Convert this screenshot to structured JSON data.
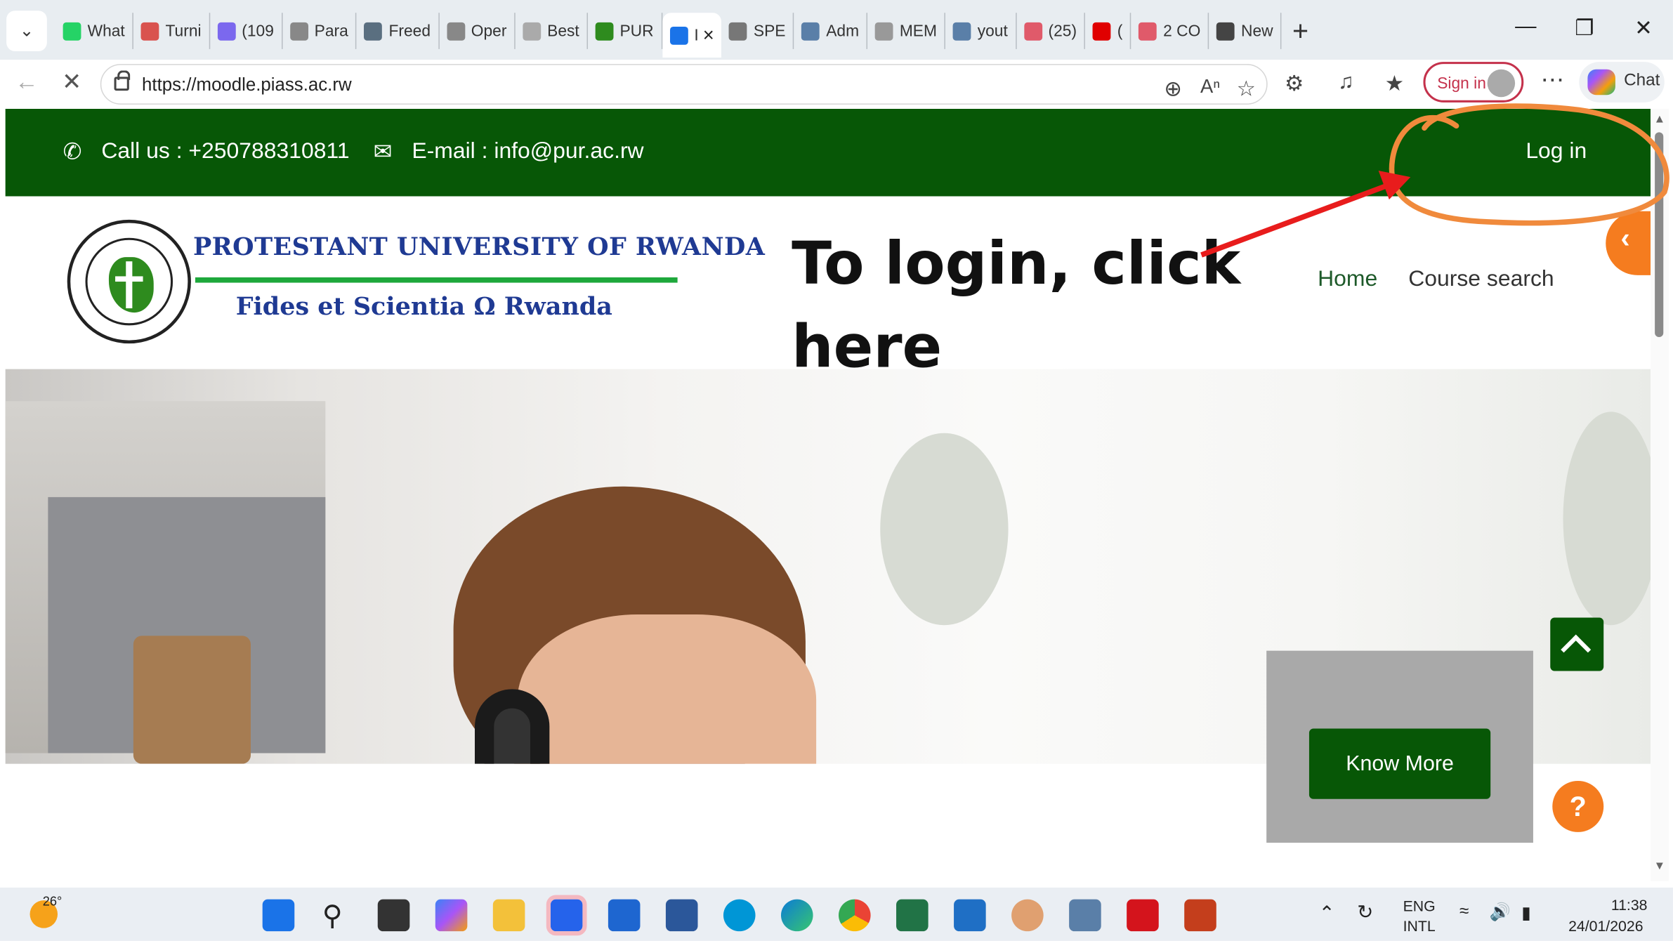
{
  "browser": {
    "tabs": [
      {
        "label": "What",
        "icon": "whatsapp-icon",
        "color": "#25d366"
      },
      {
        "label": "Turni",
        "icon": "pdf-icon",
        "color": "#d9534f"
      },
      {
        "label": "(109",
        "icon": "mail-icon",
        "color": "#7b68ee"
      },
      {
        "label": "Para",
        "icon": "openai-icon",
        "color": "#888888"
      },
      {
        "label": "Freed",
        "icon": "doc-icon",
        "color": "#5a6f80"
      },
      {
        "label": "Oper",
        "icon": "openai-icon",
        "color": "#888888"
      },
      {
        "label": "Best",
        "icon": "info-icon",
        "color": "#aaaaaa"
      },
      {
        "label": "PUR",
        "icon": "pur-icon",
        "color": "#2e8b1e"
      },
      {
        "label": "I",
        "icon": "loading-icon",
        "color": "#1a73e8",
        "active": true
      },
      {
        "label": "SPE",
        "icon": "file-icon",
        "color": "#777777"
      },
      {
        "label": "Adm",
        "icon": "admin-icon",
        "color": "#5a7fa8"
      },
      {
        "label": "MEM",
        "icon": "file-icon",
        "color": "#999999"
      },
      {
        "label": "yout",
        "icon": "search-icon",
        "color": "#5a7fa8"
      },
      {
        "label": "(25)",
        "icon": "youtube-icon",
        "color": "#e05a6a"
      },
      {
        "label": "(",
        "icon": "youtube-icon",
        "color": "#e00000"
      },
      {
        "label": "2 CO",
        "icon": "youtube-icon",
        "color": "#e05a6a"
      },
      {
        "label": "New",
        "icon": "newtab-icon",
        "color": "#444444"
      }
    ],
    "url": "https://moodle.piass.ac.rw",
    "sign_in": "Sign in",
    "chat": "Chat"
  },
  "site": {
    "phone": "Call us : +250788310811",
    "email": "E-mail : info@pur.ac.rw",
    "login": "Log in",
    "university_name": "PROTESTANT UNIVERSITY OF RWANDA",
    "motto": "Fides et Scientia Ω Rwanda",
    "nav": [
      "Home",
      "Course search"
    ],
    "know_more": "Know More",
    "help": "?",
    "brand_green": "#075706",
    "accent_orange": "#f57c1f"
  },
  "annotation": {
    "line1": "To login, click",
    "line2": "here",
    "arrow_color": "#e81c1c",
    "circle_color": "#f08a3c"
  },
  "taskbar": {
    "temperature": "26°",
    "lang1": "ENG",
    "lang2": "INTL",
    "time": "11:38",
    "date": "24/01/2026"
  }
}
